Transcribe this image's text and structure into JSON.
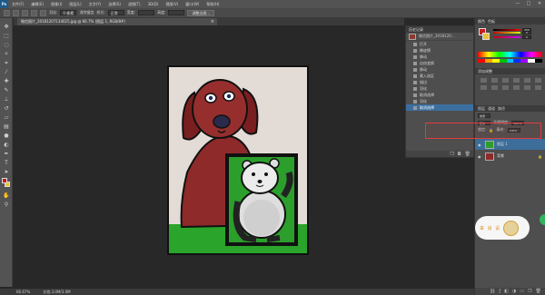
{
  "app": {
    "logo": "Ps"
  },
  "menu": {
    "items": [
      "文件(F)",
      "编辑(E)",
      "图像(I)",
      "图层(L)",
      "文字(Y)",
      "选择(S)",
      "滤镜(T)",
      "3D(D)",
      "视图(V)",
      "窗口(W)",
      "帮助(H)"
    ]
  },
  "window": {
    "min": "—",
    "max": "□",
    "close": "✕"
  },
  "options": {
    "feather_label": "羽化:",
    "feather_value": "0 像素",
    "antialias_label": "消除锯齿",
    "style_label": "样式:",
    "style_value": "正常",
    "width_label": "宽度:",
    "height_label": "高度:",
    "refine_button": "调整边缘..."
  },
  "document": {
    "tab_title": "微信图片_20181207134025.jpg @ 66.7% (图层 1, RGB/8#)",
    "close_glyph": "×"
  },
  "history": {
    "title": "历史记录",
    "snapshot_name": "微信图片_2018120...",
    "items": [
      "打开",
      "橡皮擦",
      "移动",
      "自由变换",
      "移动",
      "载入选区",
      "描边",
      "羽化",
      "取消选择",
      "羽化",
      "取消选择"
    ],
    "active_index": 10
  },
  "color_panel": {
    "tabs": [
      "颜色",
      "色板"
    ],
    "r": "255",
    "g": "0",
    "b": "0"
  },
  "adjustments": {
    "title": "添加调整"
  },
  "layers": {
    "tabs": [
      "图层",
      "通道",
      "路径"
    ],
    "kind_label": "类型",
    "blend_mode": "正常",
    "opacity_label": "不透明度:",
    "opacity_value": "100%",
    "lock_label": "锁定:",
    "fill_label": "填充:",
    "fill_value": "100%",
    "rows": [
      {
        "name": "图层 1",
        "selected": true
      },
      {
        "name": "背景",
        "selected": false
      }
    ]
  },
  "status": {
    "zoom": "66.67%",
    "doc_size": "文档:3.0M/3.0M"
  },
  "watermark": {
    "text": "来 肖 设"
  },
  "colors": {
    "fg": "#c61d1d",
    "bg": "#e8c23a",
    "highlight": "#e23b3b",
    "selection": "#3d6d99"
  }
}
